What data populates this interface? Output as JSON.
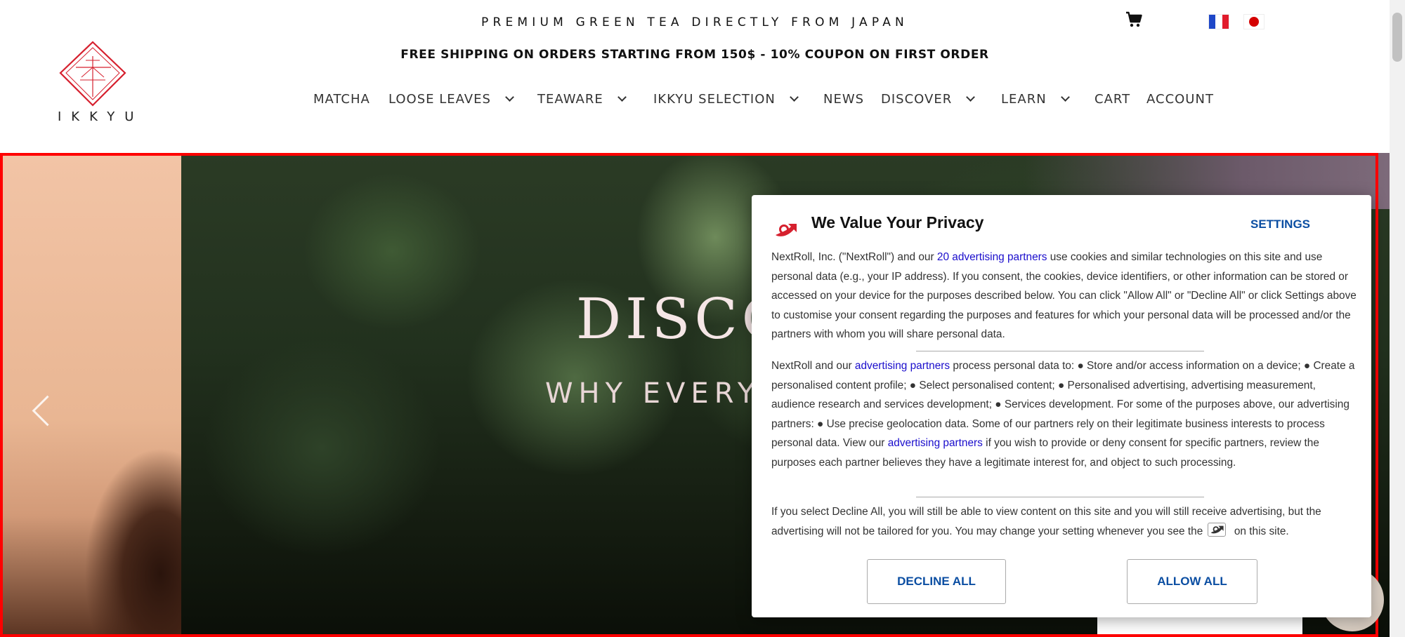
{
  "header": {
    "tagline": "PREMIUM GREEN TEA DIRECTLY FROM JAPAN",
    "shipping": "FREE SHIPPING ON ORDERS STARTING FROM 150$ - 10% COUPON ON FIRST ORDER",
    "logo_text": "IKKYU",
    "cart_icon": "cart-icon",
    "languages": [
      "fr",
      "jp"
    ]
  },
  "nav": {
    "items": [
      {
        "label": "MATCHA",
        "dropdown": false
      },
      {
        "label": "LOOSE LEAVES",
        "dropdown": true
      },
      {
        "label": "TEAWARE",
        "dropdown": true
      },
      {
        "label": "IKKYU SELECTION",
        "dropdown": true
      },
      {
        "label": "NEWS",
        "dropdown": false
      },
      {
        "label": "DISCOVER",
        "dropdown": true
      },
      {
        "label": "LEARN",
        "dropdown": true
      },
      {
        "label": "CART",
        "dropdown": false
      },
      {
        "label": "ACCOUNT",
        "dropdown": false
      }
    ]
  },
  "hero": {
    "title": "DISCO",
    "subtitle": "WHY EVERY"
  },
  "consent": {
    "title": "We Value Your Privacy",
    "settings_label": "SETTINGS",
    "p1_a": "NextRoll, Inc. (\"NextRoll\") and our ",
    "p1_link": "20 advertising partners",
    "p1_b": " use cookies and similar technologies on this site and use personal data (e.g., your IP address). If you consent, the cookies, device identifiers, or other information can be stored or accessed on your device for the purposes described below. You can click \"Allow All\" or \"Decline All\" or click Settings above to customise your consent regarding the purposes and features for which your personal data will be processed and/or the partners with whom you will share personal data.",
    "p2_a": "NextRoll and our ",
    "p2_link1": "advertising partners",
    "p2_b": " process personal data to: ● Store and/or access information on a device; ● Create a personalised content profile; ● Select personalised content; ● Personalised advertising, advertising measurement, audience research and services development; ● Services development. For some of the purposes above, our advertising partners: ● Use precise geolocation data. Some of our partners rely on their legitimate business interests to process personal data. View our ",
    "p2_link2": "advertising partners",
    "p2_c": " if you wish to provide or deny consent for specific partners, review the purposes each partner believes they have a legitimate interest for, and object to such processing.",
    "p3_a": "If you select Decline All, you will still be able to view content on this site and you will still receive advertising, but the advertising will not be tailored for you. You may change your setting whenever you see the ",
    "p3_b": " on this site.",
    "decline_label": "DECLINE ALL",
    "allow_label": "ALLOW ALL"
  },
  "colors": {
    "brand_red": "#d6202e",
    "link_blue": "#1a0dcc",
    "button_blue": "#0b4ea2",
    "hero_frame": "#ff0000"
  }
}
